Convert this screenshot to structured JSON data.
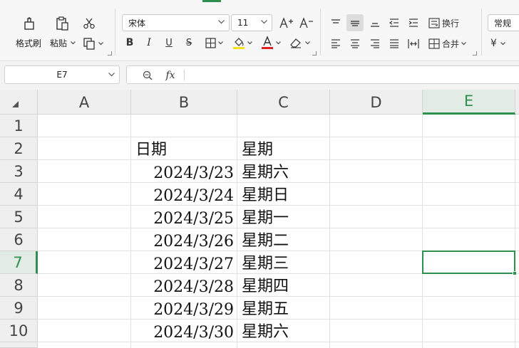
{
  "ribbon": {
    "format_painter_label": "格式刷",
    "paste_label": "粘贴",
    "font_name": "宋体",
    "font_size": "11",
    "wrap_text_label": "换行",
    "merge_label": "合并",
    "number_format": "常规"
  },
  "formula_bar": {
    "name_box": "E7",
    "fx_label": "fx",
    "formula": ""
  },
  "columns": [
    "A",
    "B",
    "C",
    "D",
    "E"
  ],
  "selected_column": "E",
  "rows": [
    "1",
    "2",
    "3",
    "4",
    "5",
    "6",
    "7",
    "8",
    "9",
    "10"
  ],
  "selected_row": "7",
  "cells": {
    "B2": "日期",
    "C2": "星期",
    "B3": "2024/3/23",
    "C3": "星期六",
    "B4": "2024/3/24",
    "C4": "星期日",
    "B5": "2024/3/25",
    "C5": "星期一",
    "B6": "2024/3/26",
    "C6": "星期二",
    "B7": "2024/3/27",
    "C7": "星期三",
    "B8": "2024/3/28",
    "C8": "星期四",
    "B9": "2024/3/29",
    "C9": "星期五",
    "B10": "2024/3/30",
    "C10": "星期六"
  },
  "colors": {
    "accent": "#2f8f4e",
    "font_color_bar": "#e02020",
    "fill_color_bar": "#f5e11b"
  }
}
